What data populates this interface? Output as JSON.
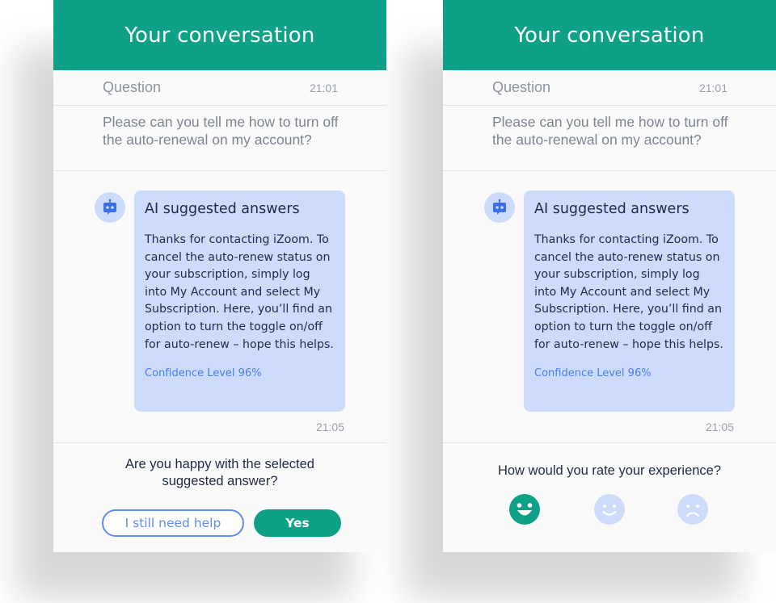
{
  "left_panel": {
    "header_title": "Your conversation",
    "question_label": "Question",
    "question_time": "21:01",
    "question_text": "Please can you tell me how to turn off the auto-renewal on my account?",
    "bubble_title": "AI suggested answers",
    "bubble_text": "Thanks for contacting iZoom. To cancel the auto-renew status on your subscription, simply log into My Account and select My Subscription. Here, you’ll find an option to turn the toggle on/off for auto-renew – hope this helps.",
    "confidence": "Confidence Level 96%",
    "answer_time": "21:05",
    "footer_question": "Are you happy with the selected suggested answer?",
    "btn_help": "I still need help",
    "btn_yes": "Yes"
  },
  "right_panel": {
    "header_title": "Your conversation",
    "question_label": "Question",
    "question_time": "21:01",
    "question_text": "Please can you tell me how to turn off the auto-renewal on my account?",
    "bubble_title": "AI suggested answers",
    "bubble_text": "Thanks for contacting iZoom. To cancel the auto-renew status on your subscription, simply log into My Account and select My Subscription. Here, you’ll find an option to turn the toggle on/off for auto-renew – hope this helps.",
    "confidence": "Confidence Level 96%",
    "answer_time": "21:05",
    "footer_question": "How would you rate your experience?",
    "ratings": [
      {
        "icon": "laughing-face-icon",
        "selected": true
      },
      {
        "icon": "smiling-face-icon",
        "selected": false
      },
      {
        "icon": "sad-face-icon",
        "selected": false
      }
    ]
  },
  "colors": {
    "header_green": "#0ea187",
    "bubble_blue": "#cddcfb",
    "accent_blue": "#5f8df3",
    "confidence_blue": "#4a7df0",
    "face_light": "#cddcfb"
  }
}
